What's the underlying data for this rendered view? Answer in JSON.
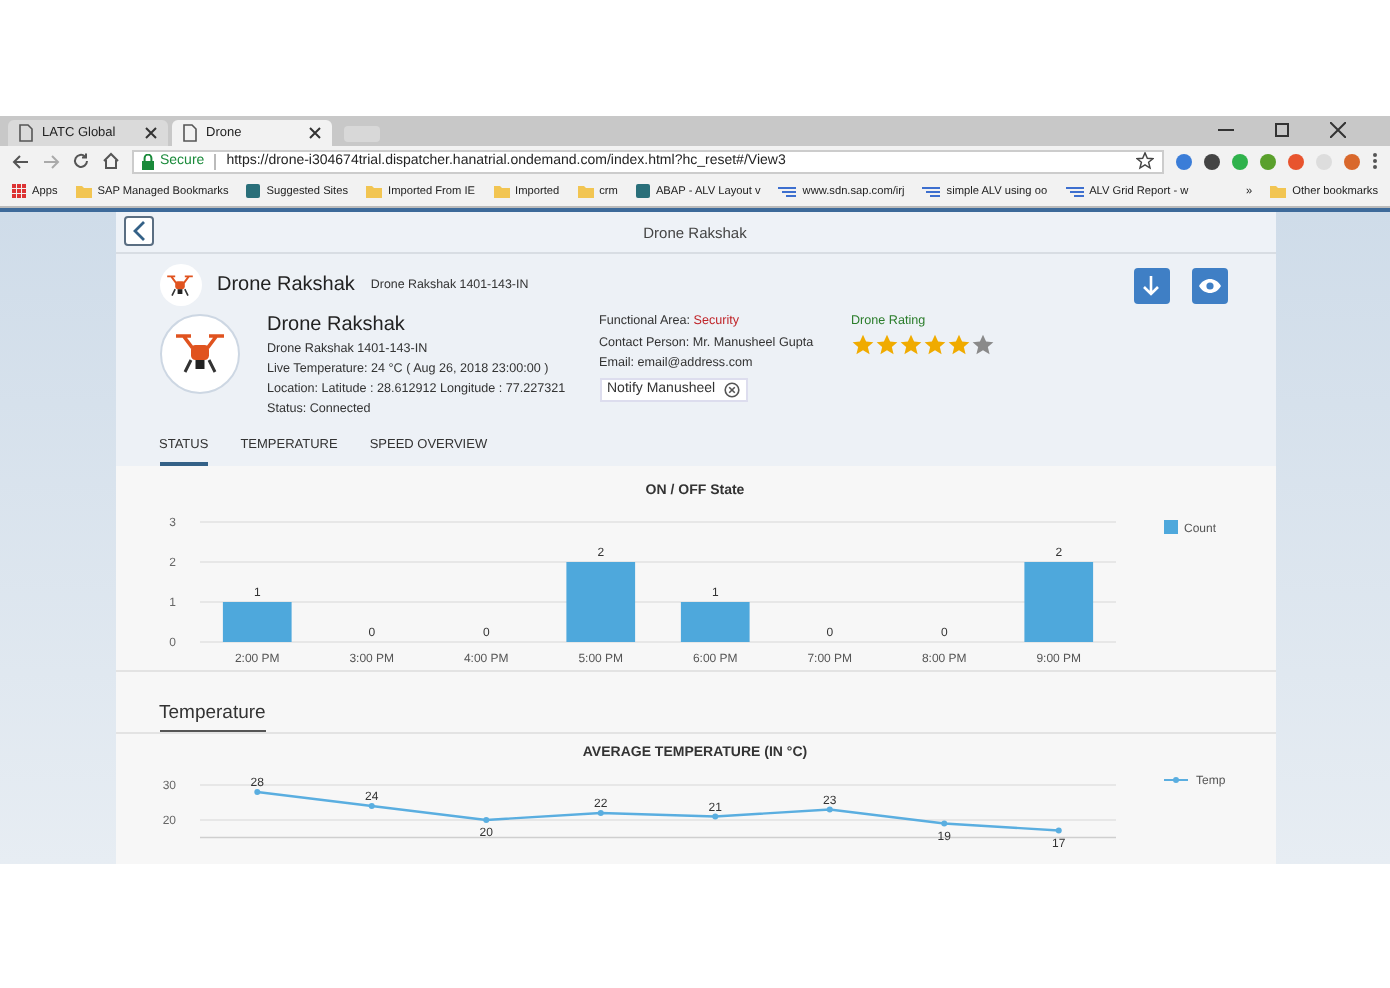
{
  "browser": {
    "tabs": [
      {
        "label": "LATC Global",
        "selected": false
      },
      {
        "label": "Drone",
        "selected": true
      }
    ],
    "secure_label": "Secure",
    "url": "https://drone-i304674trial.dispatcher.hanatrial.ondemand.com/index.html?hc_reset#/View3",
    "bookmarks": [
      {
        "label": "Apps",
        "kind": "apps"
      },
      {
        "label": "SAP Managed Bookmarks",
        "kind": "folder"
      },
      {
        "label": "Suggested Sites",
        "kind": "site"
      },
      {
        "label": "Imported From IE",
        "kind": "folder"
      },
      {
        "label": "Imported",
        "kind": "folder"
      },
      {
        "label": "crm",
        "kind": "folder"
      },
      {
        "label": "ABAP - ALV Layout v",
        "kind": "site"
      },
      {
        "label": "www.sdn.sap.com/irj",
        "kind": "link"
      },
      {
        "label": "simple ALV using oo",
        "kind": "link"
      },
      {
        "label": "ALV Grid Report - w",
        "kind": "link"
      }
    ],
    "overflow": "»",
    "other_bookmarks": "Other bookmarks"
  },
  "page": {
    "title": "Drone Rakshak",
    "header": {
      "title": "Drone Rakshak",
      "subtitle": "Drone Rakshak 1401-143-IN"
    },
    "object": {
      "name": "Drone Rakshak",
      "id": "Drone Rakshak 1401-143-IN",
      "temperature": "Live Temperature: 24 °C ( Aug 26, 2018 23:00:00 )",
      "location": "Location: Latitude : 28.612912 Longitude : 77.227321",
      "status": "Status: Connected"
    },
    "attributes": {
      "functional_area_label": "Functional Area:",
      "functional_area": "Security",
      "contact": "Contact Person: Mr. Manusheel Gupta",
      "email": "Email: email@address.com",
      "notify_button": "Notify Manusheel"
    },
    "rating": {
      "label": "Drone Rating",
      "stars": 5
    },
    "tabs": [
      {
        "label": "STATUS",
        "selected": true
      },
      {
        "label": "TEMPERATURE",
        "selected": false
      },
      {
        "label": "SPEED OVERVIEW",
        "selected": false
      }
    ],
    "status_chart": {
      "chart_data": {
        "type": "bar",
        "title": "ON / OFF State",
        "categories": [
          "2:00 PM",
          "3:00 PM",
          "4:00 PM",
          "5:00 PM",
          "6:00 PM",
          "7:00 PM",
          "8:00 PM",
          "9:00 PM"
        ],
        "series": [
          {
            "name": "Count",
            "color": "#4ea8dc",
            "values": [
              1,
              0,
              0,
              2,
              1,
              0,
              0,
              2
            ]
          }
        ],
        "ylim": [
          0,
          3
        ],
        "yticks": [
          0,
          1,
          2,
          3
        ],
        "data_labels": true
      }
    },
    "temperature_section": {
      "title": "Temperature",
      "chart_data": {
        "type": "line",
        "title": "AVERAGE TEMPERATURE (IN °C)",
        "series": [
          {
            "name": "Temp",
            "color": "#5aaee0",
            "marker": true,
            "values": [
              28,
              24,
              20,
              22,
              21,
              23,
              19,
              17
            ]
          }
        ],
        "ylim": [
          15,
          30
        ],
        "yticks": [
          20,
          30
        ],
        "data_labels": true
      }
    }
  }
}
